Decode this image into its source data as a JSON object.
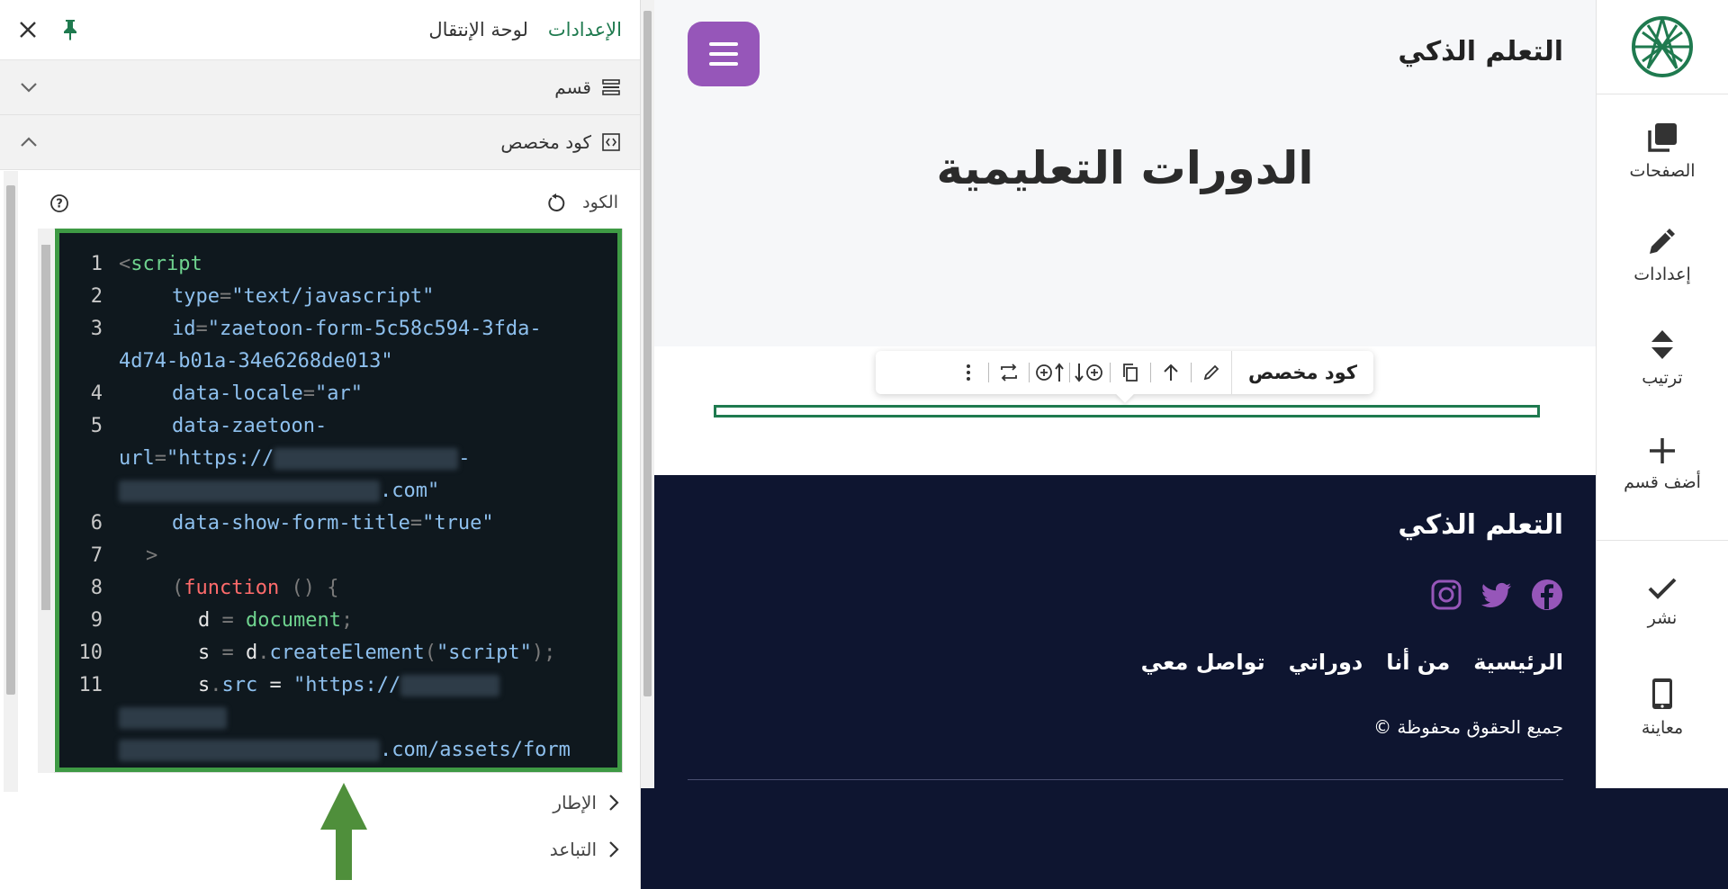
{
  "panel": {
    "tabs": [
      {
        "label": "الإعدادات",
        "active": true
      },
      {
        "label": "لوحة الإنتقال",
        "active": false
      }
    ],
    "accordions": [
      {
        "label": "قسم",
        "icon": "section-icon",
        "expanded": false
      },
      {
        "label": "كود مخصص",
        "icon": "code-icon",
        "expanded": true
      }
    ],
    "code_field": {
      "label": "الكود",
      "lines": [
        {
          "num": "1"
        },
        {
          "num": "2"
        },
        {
          "num": "3"
        },
        {
          "num": "4"
        },
        {
          "num": "5"
        },
        {
          "num": "6"
        },
        {
          "num": "7"
        },
        {
          "num": "8"
        },
        {
          "num": "9"
        },
        {
          "num": "10"
        },
        {
          "num": "11"
        }
      ]
    },
    "collapsed_options": [
      {
        "label": "الإطار"
      },
      {
        "label": "التباعد"
      }
    ]
  },
  "preview": {
    "site_title": "التعلم الذكي",
    "page_heading": "الدورات التعليمية",
    "block_toolbar": {
      "title": "كود مخصص"
    },
    "footer": {
      "brand": "التعلم الذكي",
      "nav": [
        "الرئيسية",
        "من أنا",
        "دوراتي",
        "تواصل معي"
      ],
      "copyright": "جميع الحقوق محفوظة ©"
    }
  },
  "rail": {
    "items": [
      {
        "label": "الصفحات",
        "icon": "pages-icon"
      },
      {
        "label": "إعدادات",
        "icon": "pencil-icon"
      },
      {
        "label": "ترتيب",
        "icon": "sort-icon"
      },
      {
        "label": "أضف قسم",
        "icon": "plus-icon"
      },
      {
        "label": "نشر",
        "icon": "check-icon"
      },
      {
        "label": "معاينة",
        "icon": "mobile-icon"
      }
    ]
  },
  "colors": {
    "accent_green": "#1f7a4f",
    "highlight_green": "#3e9a44",
    "purple": "#9656b9",
    "footer_navy": "#0e1530"
  }
}
